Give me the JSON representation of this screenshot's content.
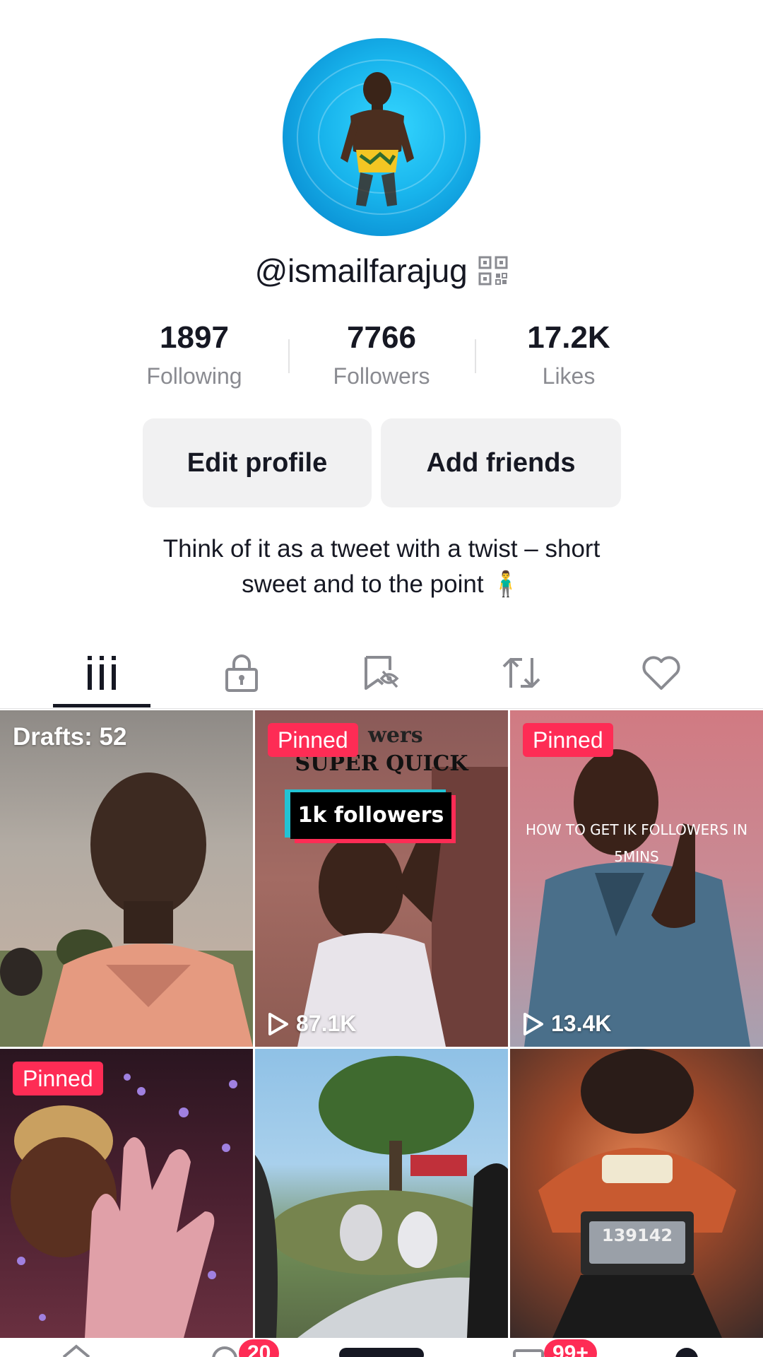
{
  "profile": {
    "username": "@ismailfarajug",
    "bio_line1": "Think of it as a tweet with a twist – short",
    "bio_line2": "sweet and to the point 🧍‍♂️"
  },
  "stats": [
    {
      "value": "1897",
      "label": "Following"
    },
    {
      "value": "7766",
      "label": "Followers"
    },
    {
      "value": "17.2K",
      "label": "Likes"
    }
  ],
  "buttons": {
    "edit_profile": "Edit profile",
    "add_friends": "Add friends"
  },
  "tabs": [
    {
      "icon": "videos-grid-icon",
      "active": true
    },
    {
      "icon": "lock-icon",
      "active": false
    },
    {
      "icon": "favorites-icon",
      "active": false
    },
    {
      "icon": "repost-icon",
      "active": false
    },
    {
      "icon": "heart-icon",
      "active": false
    }
  ],
  "videos": [
    {
      "drafts": "Drafts: 52"
    },
    {
      "pinned": "Pinned",
      "views": "87.1K",
      "overlay_top": "wers",
      "overlay_mid": "SUPER QUICK",
      "overlay_tag": "1k followers"
    },
    {
      "pinned": "Pinned",
      "views": "13.4K",
      "overlay_line1": "HOW TO GET IK FOLLOWERS IN",
      "overlay_line2": "5MINS"
    },
    {
      "pinned": "Pinned"
    },
    {},
    {
      "plate": "139142"
    }
  ],
  "nav_badges": {
    "inbox": "20",
    "notifications": "99+"
  },
  "colors": {
    "accent": "#fe2c55",
    "text": "#161823",
    "muted": "#8a8b91",
    "button_bg": "#f1f1f2"
  }
}
